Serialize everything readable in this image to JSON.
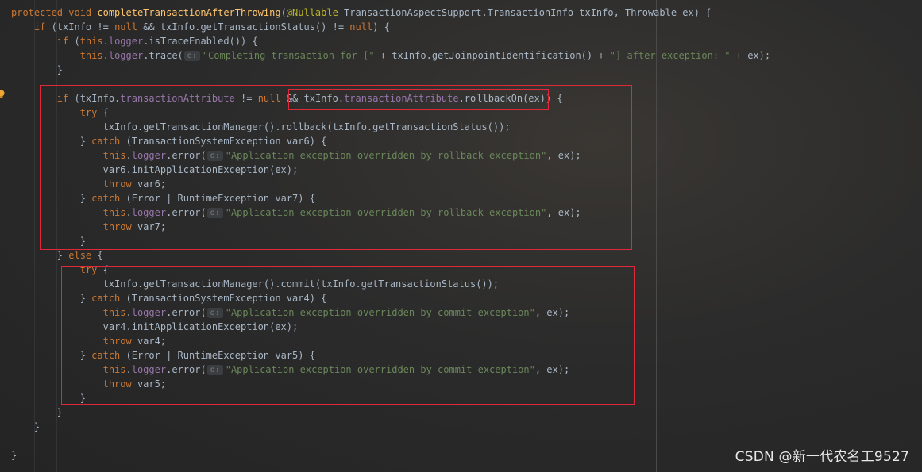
{
  "editor": {
    "lines": [
      [
        [
          "kw",
          "protected void "
        ],
        [
          "fn",
          "completeTransactionAfterThrowing"
        ],
        [
          "",
          "("
        ],
        [
          "ann",
          "@Nullable"
        ],
        [
          "",
          " TransactionAspectSupport.TransactionInfo txInfo, Throwable ex) {"
        ]
      ],
      [
        [
          "",
          "    "
        ],
        [
          "kw",
          "if"
        ],
        [
          "",
          " (txInfo != "
        ],
        [
          "kw",
          "null"
        ],
        [
          "",
          " && txInfo.getTransactionStatus() != "
        ],
        [
          "kw",
          "null"
        ],
        [
          "",
          ") {"
        ]
      ],
      [
        [
          "",
          "        "
        ],
        [
          "kw",
          "if"
        ],
        [
          "",
          " ("
        ],
        [
          "kw",
          "this"
        ],
        [
          "",
          "."
        ],
        [
          "fld",
          "logger"
        ],
        [
          "",
          ".isTraceEnabled()) {"
        ]
      ],
      [
        [
          "",
          "            "
        ],
        [
          "kw",
          "this"
        ],
        [
          "",
          "."
        ],
        [
          "fld",
          "logger"
        ],
        [
          "",
          ".trace("
        ],
        [
          "hint",
          "o:"
        ],
        [
          "str",
          "\"Completing transaction for [\""
        ],
        [
          "",
          " + txInfo.getJoinpointIdentification() + "
        ],
        [
          "str",
          "\"] after exception: \""
        ],
        [
          "",
          " + ex);"
        ]
      ],
      [
        [
          "",
          "        }"
        ]
      ],
      [
        [
          "",
          ""
        ]
      ],
      [
        [
          "",
          "        "
        ],
        [
          "kw",
          "if"
        ],
        [
          "",
          " (txInfo."
        ],
        [
          "fld",
          "transactionAttribute"
        ],
        [
          "",
          " != "
        ],
        [
          "kw",
          "null"
        ],
        [
          "",
          " && txInfo."
        ],
        [
          "fld",
          "transactionAttribute"
        ],
        [
          "",
          ".ro"
        ],
        [
          "caret",
          ""
        ],
        [
          "",
          "llbackOn(ex)) {"
        ]
      ],
      [
        [
          "",
          "            "
        ],
        [
          "kw",
          "try"
        ],
        [
          "",
          " {"
        ]
      ],
      [
        [
          "",
          "                txInfo.getTransactionManager().rollback(txInfo.getTransactionStatus());"
        ]
      ],
      [
        [
          "",
          "            } "
        ],
        [
          "kw",
          "catch"
        ],
        [
          "",
          " (TransactionSystemException var6) {"
        ]
      ],
      [
        [
          "",
          "                "
        ],
        [
          "kw",
          "this"
        ],
        [
          "",
          "."
        ],
        [
          "fld",
          "logger"
        ],
        [
          "",
          ".error("
        ],
        [
          "hint",
          "o:"
        ],
        [
          "str",
          "\"Application exception overridden by rollback exception\""
        ],
        [
          "",
          ", ex);"
        ]
      ],
      [
        [
          "",
          "                var6.initApplicationException(ex);"
        ]
      ],
      [
        [
          "",
          "                "
        ],
        [
          "kw",
          "throw"
        ],
        [
          "",
          " var6;"
        ]
      ],
      [
        [
          "",
          "            } "
        ],
        [
          "kw",
          "catch"
        ],
        [
          "",
          " (Error | RuntimeException var7) {"
        ]
      ],
      [
        [
          "",
          "                "
        ],
        [
          "kw",
          "this"
        ],
        [
          "",
          "."
        ],
        [
          "fld",
          "logger"
        ],
        [
          "",
          ".error("
        ],
        [
          "hint",
          "o:"
        ],
        [
          "str",
          "\"Application exception overridden by rollback exception\""
        ],
        [
          "",
          ", ex);"
        ]
      ],
      [
        [
          "",
          "                "
        ],
        [
          "kw",
          "throw"
        ],
        [
          "",
          " var7;"
        ]
      ],
      [
        [
          "",
          "            }"
        ]
      ],
      [
        [
          "",
          "        } "
        ],
        [
          "kw",
          "else"
        ],
        [
          "",
          " {"
        ]
      ],
      [
        [
          "",
          "            "
        ],
        [
          "kw",
          "try"
        ],
        [
          "",
          " {"
        ]
      ],
      [
        [
          "",
          "                txInfo.getTransactionManager().commit(txInfo.getTransactionStatus());"
        ]
      ],
      [
        [
          "",
          "            } "
        ],
        [
          "kw",
          "catch"
        ],
        [
          "",
          " (TransactionSystemException var4) {"
        ]
      ],
      [
        [
          "",
          "                "
        ],
        [
          "kw",
          "this"
        ],
        [
          "",
          "."
        ],
        [
          "fld",
          "logger"
        ],
        [
          "",
          ".error("
        ],
        [
          "hint",
          "o:"
        ],
        [
          "str",
          "\"Application exception overridden by commit exception\""
        ],
        [
          "",
          ", ex);"
        ]
      ],
      [
        [
          "",
          "                var4.initApplicationException(ex);"
        ]
      ],
      [
        [
          "",
          "                "
        ],
        [
          "kw",
          "throw"
        ],
        [
          "",
          " var4;"
        ]
      ],
      [
        [
          "",
          "            } "
        ],
        [
          "kw",
          "catch"
        ],
        [
          "",
          " (Error | RuntimeException var5) {"
        ]
      ],
      [
        [
          "",
          "                "
        ],
        [
          "kw",
          "this"
        ],
        [
          "",
          "."
        ],
        [
          "fld",
          "logger"
        ],
        [
          "",
          ".error("
        ],
        [
          "hint",
          "o:"
        ],
        [
          "str",
          "\"Application exception overridden by commit exception\""
        ],
        [
          "",
          ", ex);"
        ]
      ],
      [
        [
          "",
          "                "
        ],
        [
          "kw",
          "throw"
        ],
        [
          "",
          " var5;"
        ]
      ],
      [
        [
          "",
          "            }"
        ]
      ],
      [
        [
          "",
          "        }"
        ]
      ],
      [
        [
          "",
          "    }"
        ]
      ],
      [
        [
          "",
          ""
        ]
      ],
      [
        [
          "",
          "}"
        ]
      ]
    ]
  },
  "colors": {
    "keyword": "#cc7832",
    "method_decl": "#ffc66d",
    "annotation": "#bbb529",
    "field": "#9876aa",
    "string": "#6a8759",
    "plain": "#a9b7c6",
    "highlight_box": "#e0283a"
  },
  "icons": {
    "gutter_marker": "bulb-icon"
  },
  "watermark": "CSDN @新一代农名工9527"
}
